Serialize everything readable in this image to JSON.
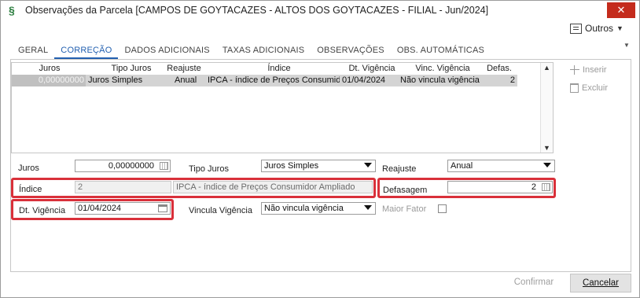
{
  "window": {
    "title": "Observações da Parcela [CAMPOS DE GOYTACAZES - ALTOS DOS GOYTACAZES - FILIAL - Jun/2024]",
    "close_glyph": "✕",
    "app_glyph": "§"
  },
  "toolbar": {
    "outros_label": "Outros",
    "outros_icon": "list-icon"
  },
  "tabs": [
    {
      "label": "GERAL"
    },
    {
      "label": "CORREÇÃO"
    },
    {
      "label": "DADOS ADICIONAIS"
    },
    {
      "label": "TAXAS ADICIONAIS"
    },
    {
      "label": "OBSERVAÇÕES"
    },
    {
      "label": "OBS. AUTOMÁTICAS"
    }
  ],
  "grid": {
    "columns": [
      "Juros",
      "Tipo Juros",
      "Reajuste",
      "Índice",
      "Dt. Vigência",
      "Vinc. Vigência",
      "Defas."
    ],
    "rows": [
      [
        "0,00000000",
        "Juros Simples",
        "Anual",
        "IPCA - índice de Preços Consumidor Ampliado",
        "01/04/2024",
        "Não vincula vigência",
        "2"
      ]
    ]
  },
  "side_buttons": {
    "insert_label": "Inserir",
    "delete_label": "Excluir"
  },
  "form": {
    "juros_label": "Juros",
    "juros_value": "0,00000000",
    "tipo_juros_label": "Tipo Juros",
    "tipo_juros_value": "Juros Simples",
    "reajuste_label": "Reajuste",
    "reajuste_value": "Anual",
    "indice_label": "Índice",
    "indice_code": "2",
    "indice_desc": "IPCA - índice de Preços Consumidor Ampliado",
    "defasagem_label": "Defasagem",
    "defasagem_value": "2",
    "dt_vigencia_label": "Dt. Vigência",
    "dt_vigencia_value": "01/04/2024",
    "vincula_vigencia_label": "Vincula Vigência",
    "vincula_vigencia_value": "Não vincula vigência",
    "maior_fator_label": "Maior Fator"
  },
  "footer": {
    "confirm_label": "Confirmar",
    "cancel_label": "Cancelar"
  },
  "colors": {
    "highlight": "#d9303a",
    "tab_active": "#2360b0",
    "close": "#c42b1c"
  }
}
